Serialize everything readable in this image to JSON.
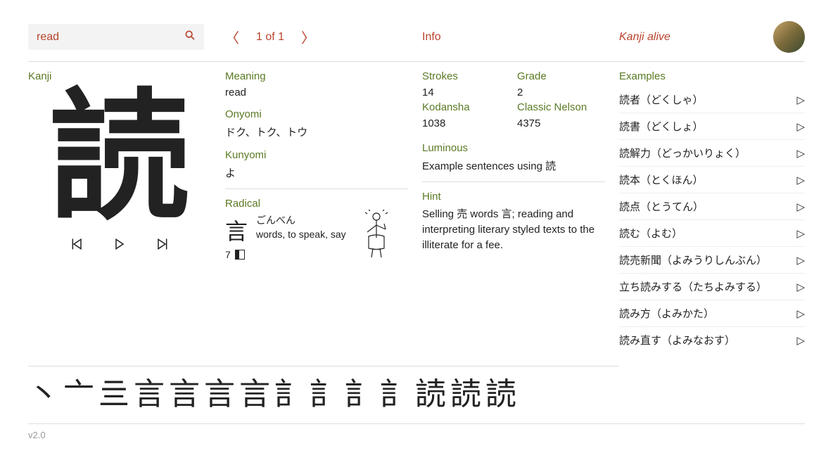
{
  "search": {
    "value": "read"
  },
  "pager": {
    "label": "1 of 1"
  },
  "header": {
    "info": "Info",
    "brand": "Kanji alive"
  },
  "labels": {
    "kanji": "Kanji",
    "meaning": "Meaning",
    "onyomi": "Onyomi",
    "kunyomi": "Kunyomi",
    "radical": "Radical",
    "strokes": "Strokes",
    "grade": "Grade",
    "kodansha": "Kodansha",
    "classic_nelson": "Classic Nelson",
    "luminous": "Luminous",
    "hint": "Hint",
    "examples": "Examples"
  },
  "kanji": {
    "glyph": "読",
    "meaning": "read",
    "onyomi": "ドク、トク、トウ",
    "kunyomi": "よ",
    "strokes": "14",
    "grade": "2",
    "kodansha": "1038",
    "classic_nelson": "4375",
    "luminous": "Example sentences using 読",
    "hint": "Selling 売 words 言; reading and interpreting literary styled texts to the illiterate for a fee."
  },
  "radical": {
    "glyph": "言",
    "hiragana": "ごんべん",
    "english": "words, to speak, say",
    "strokes": "7"
  },
  "examples": [
    "読者（どくしゃ）",
    "読書（どくしょ）",
    "読解力（どっかいりょく）",
    "読本（とくほん）",
    "読点（とうてん）",
    "読む（よむ）",
    "読売新聞（よみうりしんぶん）",
    "立ち読みする（たちよみする）",
    "読み方（よみかた）",
    "読み直す（よみなおす）"
  ],
  "stroke_sequence": [
    "丶",
    "亠",
    "亖",
    "言",
    "言",
    "言",
    "言",
    "訁",
    "訁",
    "訁",
    "訁",
    "読",
    "読",
    "読"
  ],
  "footer": {
    "version": "v2.0"
  }
}
